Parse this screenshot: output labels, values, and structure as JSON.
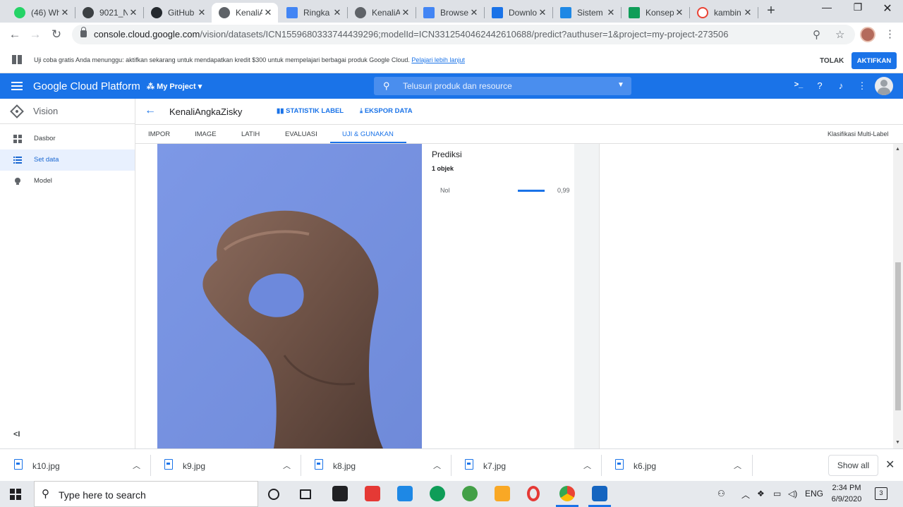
{
  "browser": {
    "tabs": [
      {
        "title": "(46) Wh",
        "fav": "#25d366"
      },
      {
        "title": "9021_N",
        "fav": "#3c4043"
      },
      {
        "title": "GitHub",
        "fav": "#24292e"
      },
      {
        "title": "KenaliA",
        "fav": "#5f6368",
        "active": true
      },
      {
        "title": "Ringka",
        "fav": "#4285f4"
      },
      {
        "title": "KenaliA",
        "fav": "#5f6368"
      },
      {
        "title": "Browse",
        "fav": "#4285f4"
      },
      {
        "title": "Downlo",
        "fav": "#1a73e8"
      },
      {
        "title": "Sistem",
        "fav": "#1e88e5"
      },
      {
        "title": "Konsep",
        "fav": "#0f9d58"
      },
      {
        "title": "kambin",
        "fav": "#ea4335"
      }
    ],
    "url_host": "console.cloud.google.com",
    "url_path": "/vision/datasets/ICN1559680333744439296;modelId=ICN3312540462442610688/predict?authuser=1&project=my-project-273506"
  },
  "banner": {
    "text": "Uji coba gratis Anda menunggu: aktifkan sekarang untuk mendapatkan kredit $300 untuk mempelajari berbagai produk Google Cloud.",
    "link": "Pelajari lebih lanjut",
    "dismiss_label": "TOLAK",
    "activate_label": "AKTIFKAN"
  },
  "header": {
    "title": "Google Cloud Platform",
    "project": "My Project",
    "search_placeholder": "Telusuri produk dan resource"
  },
  "sidebar": {
    "product": "Vision",
    "items": [
      {
        "label": "Dasbor"
      },
      {
        "label": "Set data",
        "selected": true
      },
      {
        "label": "Model"
      }
    ],
    "collapse": "<I"
  },
  "dataset": {
    "name": "KenaliAngkaZisky",
    "label_stats": "STATISTIK LABEL",
    "export": "EKSPOR DATA",
    "tabs": [
      "IMPOR",
      "IMAGE",
      "LATIH",
      "EVALUASI",
      "UJI & GUNAKAN"
    ],
    "active_tab": "UJI & GUNAKAN",
    "classification": "Klasifikasi Multi-Label"
  },
  "prediction": {
    "title": "Prediksi",
    "count": "1 objek",
    "results": [
      {
        "label": "Nol",
        "score": "0,99",
        "value": 0.99
      }
    ]
  },
  "downloads": {
    "files": [
      "k10.jpg",
      "k9.jpg",
      "k8.jpg",
      "k7.jpg",
      "k6.jpg"
    ],
    "show_all": "Show all"
  },
  "taskbar": {
    "search_placeholder": "Type here to search",
    "language": "ENG",
    "time": "2:34 PM",
    "date": "6/9/2020",
    "notifications": "3"
  }
}
